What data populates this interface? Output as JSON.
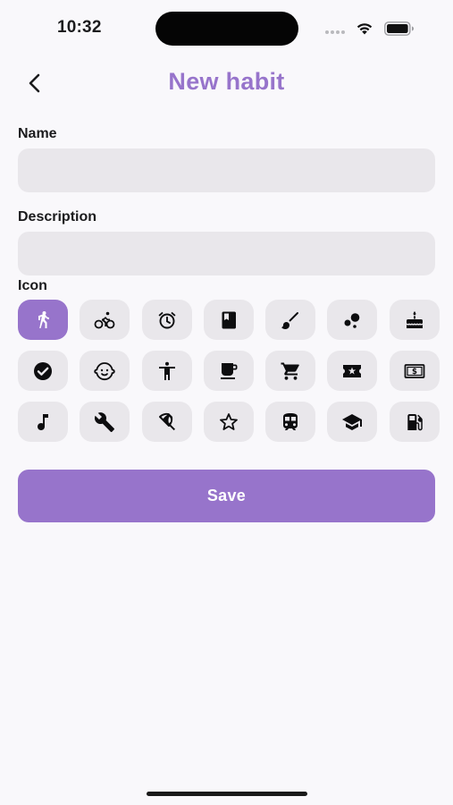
{
  "status_bar": {
    "time": "10:32"
  },
  "header": {
    "title": "New habit",
    "back_icon": "chevron-left-icon"
  },
  "form": {
    "name_label": "Name",
    "name_value": "",
    "description_label": "Description",
    "description_value": "",
    "icon_label": "Icon"
  },
  "icons": [
    {
      "name": "walk-icon",
      "selected": true
    },
    {
      "name": "bicycle-icon",
      "selected": false
    },
    {
      "name": "alarm-clock-icon",
      "selected": false
    },
    {
      "name": "book-icon",
      "selected": false
    },
    {
      "name": "paint-brush-icon",
      "selected": false
    },
    {
      "name": "bubbles-icon",
      "selected": false
    },
    {
      "name": "cake-icon",
      "selected": false
    },
    {
      "name": "check-circle-icon",
      "selected": false
    },
    {
      "name": "baby-face-icon",
      "selected": false
    },
    {
      "name": "accessibility-icon",
      "selected": false
    },
    {
      "name": "coffee-cup-icon",
      "selected": false
    },
    {
      "name": "shopping-cart-icon",
      "selected": false
    },
    {
      "name": "ticket-icon",
      "selected": false
    },
    {
      "name": "money-bill-icon",
      "selected": false
    },
    {
      "name": "music-note-icon",
      "selected": false
    },
    {
      "name": "wrench-icon",
      "selected": false
    },
    {
      "name": "beach-umbrella-icon",
      "selected": false
    },
    {
      "name": "star-outline-icon",
      "selected": false
    },
    {
      "name": "train-icon",
      "selected": false
    },
    {
      "name": "graduation-cap-icon",
      "selected": false
    },
    {
      "name": "gas-pump-icon",
      "selected": false
    }
  ],
  "actions": {
    "save_label": "Save"
  },
  "colors": {
    "accent": "#9774cb",
    "field_background": "#e9e7eb",
    "page_background": "#f9f8fb"
  }
}
